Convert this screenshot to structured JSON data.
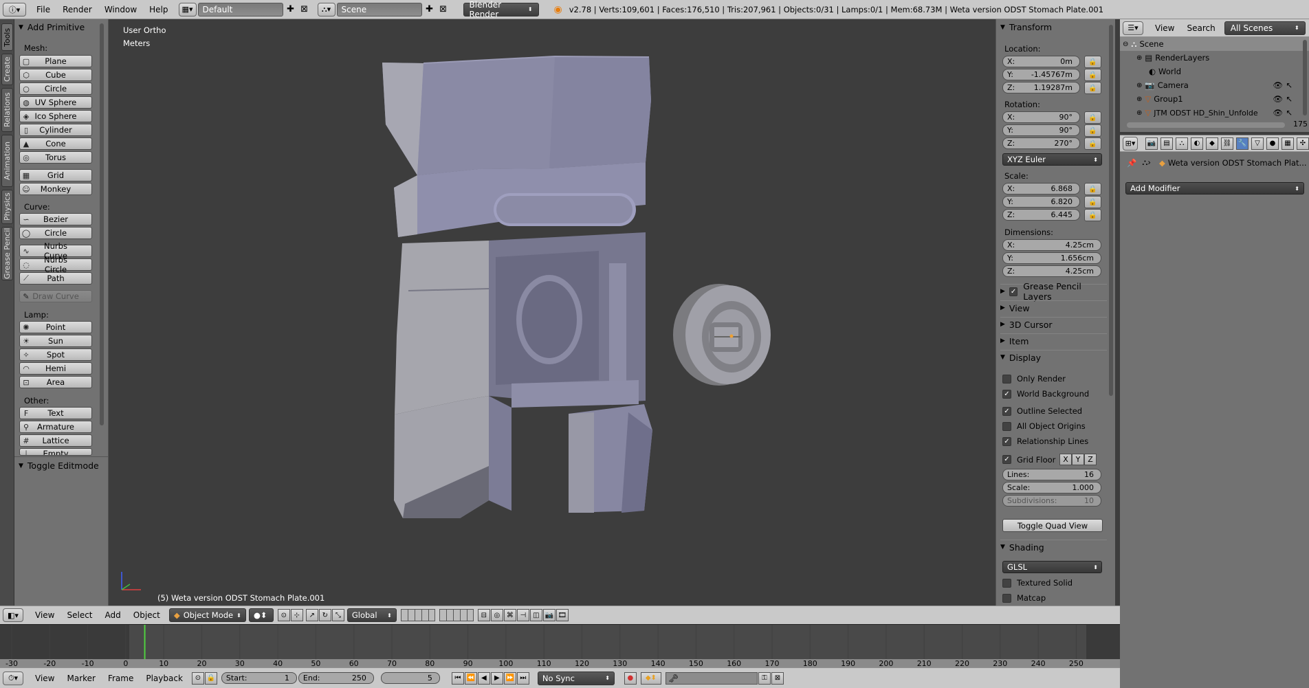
{
  "topbar": {
    "menus": [
      "File",
      "Render",
      "Window",
      "Help"
    ],
    "layout": "Default",
    "scene": "Scene",
    "engine": "Blender Render",
    "stats": "v2.78 | Verts:109,601 | Faces:176,510 | Tris:207,961 | Objects:0/31 | Lamps:0/1 | Mem:68.73M | Weta version ODST Stomach Plate.001"
  },
  "tabs": [
    "Tools",
    "Create",
    "Relations",
    "Animation",
    "Physics",
    "Grease Pencil"
  ],
  "toolshelf": {
    "header": "Add Primitive",
    "mesh_label": "Mesh:",
    "mesh": [
      "Plane",
      "Cube",
      "Circle",
      "UV Sphere",
      "Ico Sphere",
      "Cylinder",
      "Cone",
      "Torus"
    ],
    "mesh2": [
      "Grid",
      "Monkey"
    ],
    "curve_label": "Curve:",
    "curve": [
      "Bezier",
      "Circle"
    ],
    "curve2": [
      "Nurbs Curve",
      "Nurbs Circle",
      "Path"
    ],
    "draw_curve": "Draw Curve",
    "lamp_label": "Lamp:",
    "lamp": [
      "Point",
      "Sun",
      "Spot",
      "Hemi",
      "Area"
    ],
    "other_label": "Other:",
    "other": [
      "Text",
      "Armature",
      "Lattice",
      "Empty"
    ],
    "toggle_editmode": "Toggle Editmode"
  },
  "viewport": {
    "view_name": "User Ortho",
    "units": "Meters",
    "object_label": "(5) Weta version ODST Stomach Plate.001"
  },
  "npanel": {
    "transform": "Transform",
    "location_label": "Location:",
    "location": [
      "0m",
      "-1.45767m",
      "1.19287m"
    ],
    "rotation_label": "Rotation:",
    "rotation": [
      "90°",
      "90°",
      "270°"
    ],
    "rotation_mode": "XYZ Euler",
    "scale_label": "Scale:",
    "scale": [
      "6.868",
      "6.820",
      "6.445"
    ],
    "dimensions_label": "Dimensions:",
    "dimensions": [
      "4.25cm",
      "1.656cm",
      "4.25cm"
    ],
    "axes": [
      "X:",
      "Y:",
      "Z:"
    ],
    "grease_pencil_layers": "Grease Pencil Layers",
    "view": "View",
    "cursor": "3D Cursor",
    "item": "Item",
    "display": "Display",
    "display_checks": [
      {
        "label": "Only Render",
        "checked": false
      },
      {
        "label": "World Background",
        "checked": true
      },
      {
        "label": "Outline Selected",
        "checked": true
      },
      {
        "label": "All Object Origins",
        "checked": false
      },
      {
        "label": "Relationship Lines",
        "checked": true
      }
    ],
    "grid_floor": "Grid Floor",
    "grid_axes": [
      "X",
      "Y",
      "Z"
    ],
    "lines_label": "Lines:",
    "lines": "16",
    "scale2_label": "Scale:",
    "scale2": "1.000",
    "subdiv_label": "Subdivisions:",
    "subdiv": "10",
    "toggle_quad": "Toggle Quad View",
    "shading": "Shading",
    "shading_mode": "GLSL",
    "textured_solid": "Textured Solid",
    "matcap": "Matcap"
  },
  "outliner": {
    "menus": [
      "View",
      "Search"
    ],
    "scenes": "All Scenes",
    "rows": [
      "Scene",
      "RenderLayers",
      "World",
      "Camera",
      "Group1",
      "JTM ODST HD_Shin_Unfolde"
    ],
    "scroll_number": "175"
  },
  "properties": {
    "object_name": "Weta version ODST Stomach Plat...",
    "add_modifier": "Add Modifier"
  },
  "vp_header": {
    "menus": [
      "View",
      "Select",
      "Add",
      "Object"
    ],
    "mode": "Object Mode",
    "orientation": "Global"
  },
  "timeline": {
    "ticks": [
      "-30",
      "-20",
      "-10",
      "0",
      "10",
      "20",
      "30",
      "40",
      "50",
      "60",
      "70",
      "80",
      "90",
      "100",
      "110",
      "120",
      "130",
      "140",
      "150",
      "160",
      "170",
      "180",
      "190",
      "200",
      "210",
      "220",
      "230",
      "240",
      "250"
    ],
    "current_frame": 5,
    "menus": [
      "View",
      "Marker",
      "Frame",
      "Playback"
    ],
    "start_label": "Start:",
    "start": "1",
    "end_label": "End:",
    "end": "250",
    "frame": "5",
    "sync": "No Sync"
  }
}
